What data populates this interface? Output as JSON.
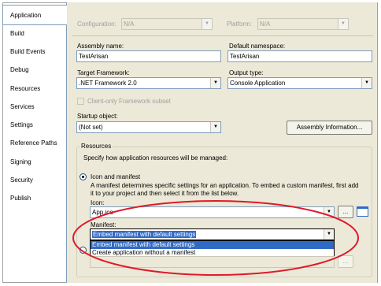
{
  "tabs": [
    {
      "label": "Application",
      "active": true
    },
    {
      "label": "Build"
    },
    {
      "label": "Build Events"
    },
    {
      "label": "Debug"
    },
    {
      "label": "Resources"
    },
    {
      "label": "Services"
    },
    {
      "label": "Settings"
    },
    {
      "label": "Reference Paths"
    },
    {
      "label": "Signing"
    },
    {
      "label": "Security"
    },
    {
      "label": "Publish"
    }
  ],
  "config": {
    "configuration_label": "Configuration:",
    "configuration_value": "N/A",
    "platform_label": "Platform:",
    "platform_value": "N/A"
  },
  "form": {
    "assembly_name_label": "Assembly name:",
    "assembly_name_value": "TestArisan",
    "default_namespace_label": "Default namespace:",
    "default_namespace_value": "TestArisan",
    "target_framework_label": "Target Framework:",
    "target_framework_value": ".NET Framework 2.0",
    "output_type_label": "Output type:",
    "output_type_value": "Console Application",
    "client_only_label": "Client-only Framework subset",
    "startup_object_label": "Startup object:",
    "startup_object_value": "(Not set)",
    "assembly_info_button": "Assembly Information..."
  },
  "resources": {
    "group_label": "Resources",
    "description": "Specify how application resources will be managed:",
    "icon_manifest_option": "Icon and manifest",
    "icon_manifest_desc_1": "A manifest determines specific settings for an application. To embed a custom manifest, first add",
    "icon_manifest_desc_2": "it to your project and then select it from the list below.",
    "icon_label": "Icon:",
    "icon_value": "App.ico",
    "browse_label": "...",
    "manifest_label": "Manifest:",
    "manifest_value": "Embed manifest with default settings",
    "manifest_options": [
      "Embed manifest with default settings",
      "Create application without a manifest"
    ]
  },
  "colors": {
    "highlight_ellipse": "#e0192b",
    "selection": "#316ac5"
  }
}
